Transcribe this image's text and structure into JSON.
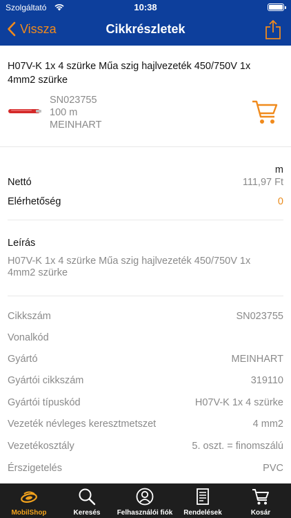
{
  "status_bar": {
    "carrier": "Szolgáltató",
    "time": "10:38"
  },
  "nav": {
    "back_label": "Vissza",
    "title": "Cikkrészletek"
  },
  "product": {
    "name": "H07V-K 1x   4  szürke Műa szig hajlvezeték 450/750V 1x 4mm2 szürke",
    "code": "SN023755",
    "length": "100 m",
    "manufacturer": "MEINHART"
  },
  "pricing": {
    "unit": "m",
    "net_label": "Nettó",
    "net_value": "111,97 Ft",
    "availability_label": "Elérhetőség",
    "availability_value": "0"
  },
  "description": {
    "title": "Leírás",
    "text": "H07V-K 1x   4  szürke Műa szig hajlvezeték 450/750V 1x 4mm2 szürke"
  },
  "specs": [
    {
      "label": "Cikkszám",
      "value": "SN023755"
    },
    {
      "label": "Vonalkód",
      "value": ""
    },
    {
      "label": "Gyártó",
      "value": "MEINHART"
    },
    {
      "label": "Gyártói cikkszám",
      "value": "319110"
    },
    {
      "label": "Gyártói típuskód",
      "value": "H07V-K 1x   4 szürke"
    },
    {
      "label": "Vezeték névleges keresztmetszet",
      "value": "4 mm2"
    },
    {
      "label": "Vezetékosztály",
      "value": "5. oszt. = finomszálú"
    },
    {
      "label": "Érszigetelés",
      "value": "PVC"
    }
  ],
  "tabs": [
    {
      "label": "MobilShop",
      "icon": "mobilshop-logo-icon",
      "active": true
    },
    {
      "label": "Keresés",
      "icon": "search-icon",
      "active": false
    },
    {
      "label": "Felhasználói fiók",
      "icon": "user-icon",
      "active": false
    },
    {
      "label": "Rendelések",
      "icon": "orders-icon",
      "active": false
    },
    {
      "label": "Kosár",
      "icon": "cart-icon",
      "active": false
    }
  ],
  "colors": {
    "nav_background": "#0d3f9c",
    "accent_orange": "#f08a1c",
    "tabbar_background": "#1e1e1e",
    "cable_red": "#d42a2a"
  }
}
